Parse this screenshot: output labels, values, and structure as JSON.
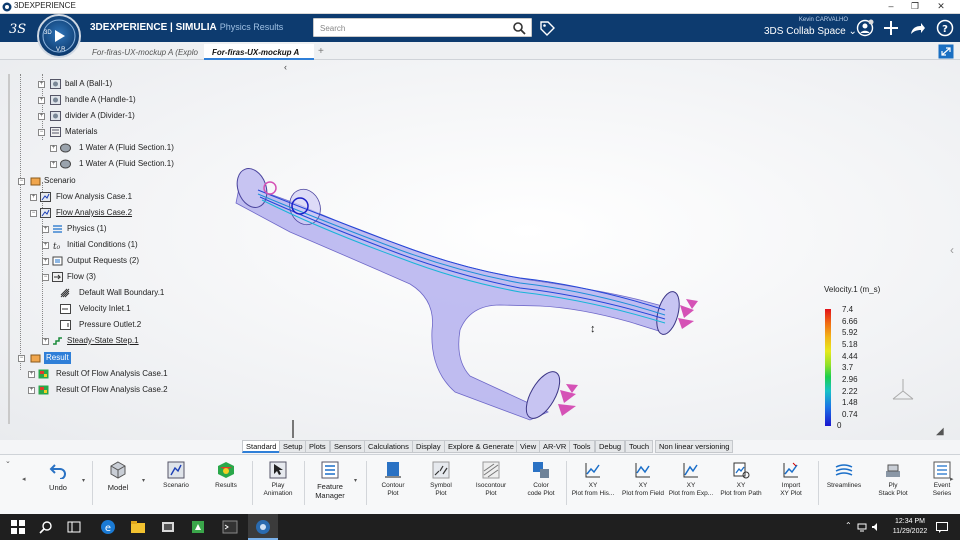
{
  "window": {
    "title": "3DEXPERIENCE",
    "minimize": "–",
    "restore": "❐",
    "close": "✕"
  },
  "header": {
    "brand_main": "3DEXPERIENCE | SIMULIA",
    "brand_sub": "Physics Results",
    "search_placeholder": "Search",
    "user_name": "Kevin CARVALHO",
    "collab_space": "3DS Collab Space",
    "compass_label": "V,R",
    "compass_3d": "3D"
  },
  "tabs": [
    {
      "label": "For-firas-UX-mockup A (Explo"
    },
    {
      "label": "For-firas-UX-mockup A"
    },
    {
      "label": "+"
    }
  ],
  "tree": [
    {
      "label": "ball A (Ball-1)"
    },
    {
      "label": "handle A (Handle-1)"
    },
    {
      "label": "divider A (Divider-1)"
    },
    {
      "label": "Materials"
    },
    {
      "label": "1 Water A (Fluid Section.1)"
    },
    {
      "label": "1 Water A (Fluid Section.1)"
    },
    {
      "label": "Scenario"
    },
    {
      "label": "Flow Analysis Case.1"
    },
    {
      "label": "Flow Analysis Case.2"
    },
    {
      "label": "Physics (1)"
    },
    {
      "label": "Initial Conditions (1)"
    },
    {
      "label": "Output Requests (2)"
    },
    {
      "label": "Flow (3)"
    },
    {
      "label": "Default Wall Boundary.1"
    },
    {
      "label": "Velocity Inlet.1"
    },
    {
      "label": "Pressure Outlet.2"
    },
    {
      "label": "Steady-State Step.1"
    },
    {
      "label": "Result"
    },
    {
      "label": "Result Of Flow Analysis Case.1"
    },
    {
      "label": "Result Of Flow Analysis Case.2"
    }
  ],
  "legend": {
    "title": "Velocity.1 (m_s)",
    "values": [
      "7.4",
      "6.66",
      "5.92",
      "5.18",
      "4.44",
      "3.7",
      "2.96",
      "2.22",
      "1.48",
      "0.74",
      "0"
    ]
  },
  "toolbar_tabs": [
    "Standard",
    "Setup",
    "Plots",
    "Sensors",
    "Calculations",
    "Display",
    "Explore & Generate",
    "View",
    "AR-VR",
    "Tools",
    "Debug",
    "Touch",
    "Non linear versioning"
  ],
  "ribbon": {
    "undo": "Undo",
    "model": "Model",
    "scenario": "Scenario",
    "results": "Results",
    "play": "Play\nAnimation",
    "feature_manager": "Feature\nManager",
    "contour": "Contour\nPlot",
    "symbol": "Symbol\nPlot",
    "isocontour": "Isocontour\nPlot",
    "color_code": "Color\ncode Plot",
    "xy_his": "XY\nPlot from His...",
    "xy_field": "XY\nPlot from Field",
    "xy_exp": "XY\nPlot from Exp...",
    "xy_path": "XY\nPlot from Path",
    "import_xy": "Import\nXY Plot",
    "streamlines": "Streamlines",
    "ply_stack": "Ply\nStack Plot",
    "event_series": "Event\nSeries"
  },
  "taskbar": {
    "time": "12:34 PM",
    "date": "11/29/2022"
  },
  "colors": {
    "header": "#0d3b6f",
    "accent": "#2f7fd8",
    "taskbar": "#1f1f1f"
  }
}
